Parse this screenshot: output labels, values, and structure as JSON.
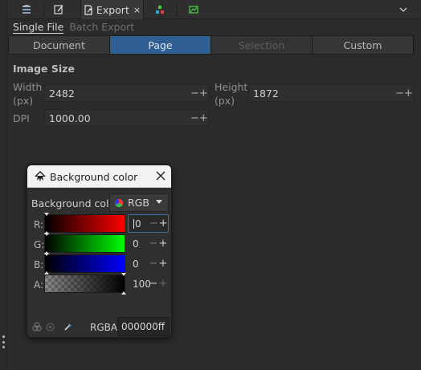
{
  "tabs": {
    "export_label": "Export",
    "export_close": "×"
  },
  "subtabs": {
    "single_file": "Single File",
    "batch_export": "Batch Export"
  },
  "area": {
    "document": "Document",
    "page": "Page",
    "selection": "Selection",
    "custom": "Custom",
    "active": "Page"
  },
  "image_size": {
    "title": "Image Size",
    "width_label_1": "Width",
    "width_label_2": "(px)",
    "width_value": "2482",
    "height_label_1": "Height",
    "height_label_2": "(px)",
    "height_value": "1872",
    "dpi_label": "DPI",
    "dpi_value": "1000.00",
    "minus": "−",
    "plus": "+"
  },
  "dialog": {
    "title": "Background color",
    "bg_label": "Background color",
    "mode": "RGB",
    "channels": [
      {
        "label": "R:",
        "value": "0"
      },
      {
        "label": "G:",
        "value": "0"
      },
      {
        "label": "B:",
        "value": "0"
      },
      {
        "label": "A:",
        "value": "100"
      }
    ],
    "rgba_label": "RGBA:",
    "rgba_value": "000000ff"
  },
  "colors": {
    "accent": "#2f5e92",
    "background": "#2b2b2b",
    "dialog_header": "#f2f2f2"
  },
  "icons": [
    "layers-icon",
    "edit-icon",
    "export-icon",
    "xml-editor-icon",
    "image-export-icon",
    "chevron-down-icon",
    "color-wheel-icon",
    "close-icon",
    "color-managed-icon",
    "out-of-gamut-icon",
    "eyedropper-icon"
  ]
}
